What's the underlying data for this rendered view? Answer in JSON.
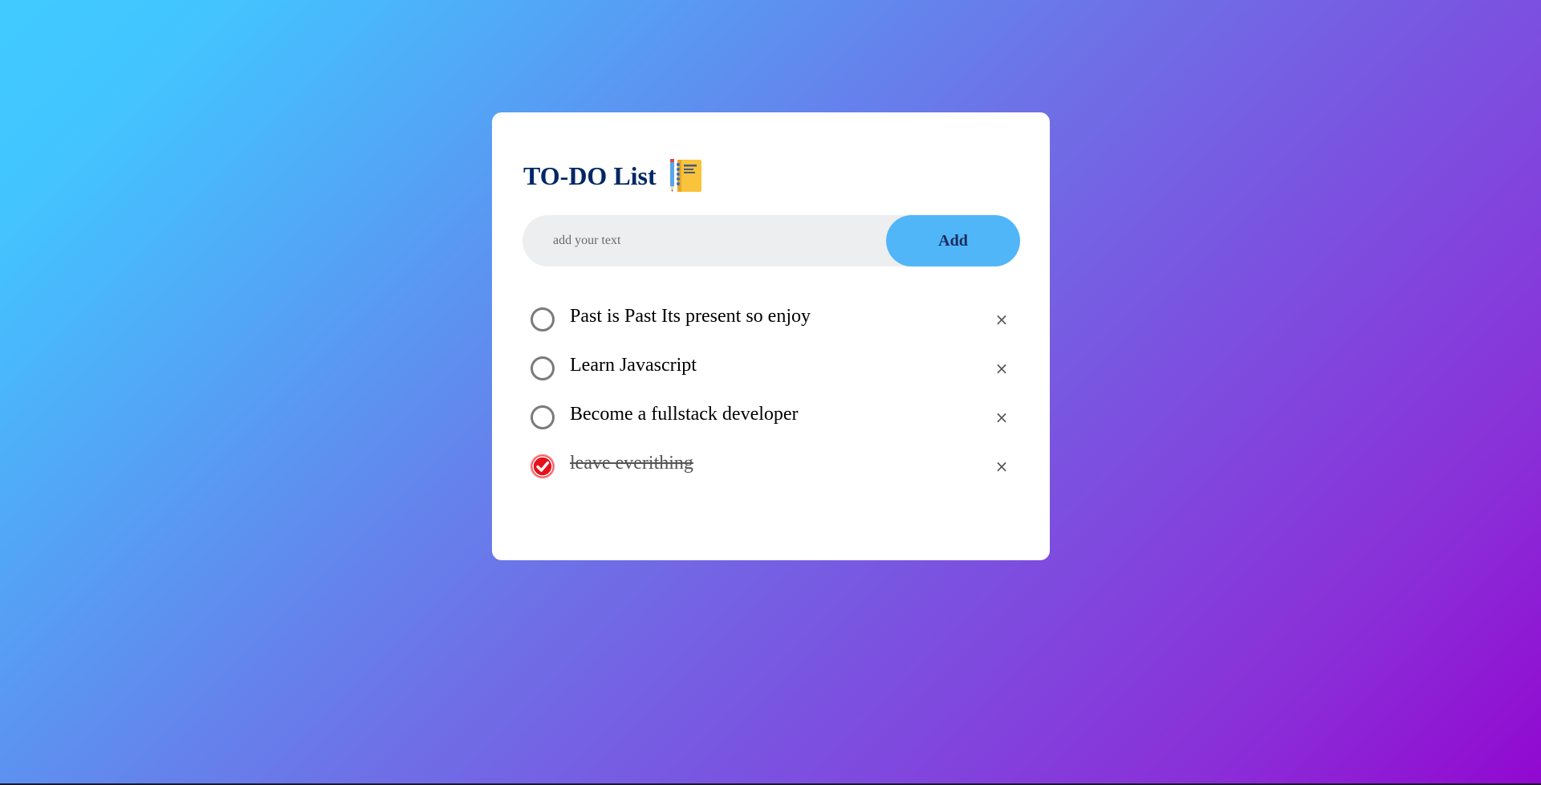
{
  "app": {
    "title": "TO-DO List",
    "title_icon": "notebook-icon"
  },
  "input": {
    "value": "",
    "placeholder": "add your text",
    "add_label": "Add"
  },
  "tasks": [
    {
      "text": "Past is Past Its present so enjoy",
      "checked": false,
      "delete_label": "×"
    },
    {
      "text": "Learn Javascript",
      "checked": false,
      "delete_label": "×"
    },
    {
      "text": "Become a fullstack developer",
      "checked": false,
      "delete_label": "×"
    },
    {
      "text": "leave everithing",
      "checked": true,
      "delete_label": "×"
    }
  ],
  "colors": {
    "title": "#002765",
    "add_button": "#50b6f7",
    "checked": "#e8101a",
    "input_bg": "#edeef0"
  }
}
